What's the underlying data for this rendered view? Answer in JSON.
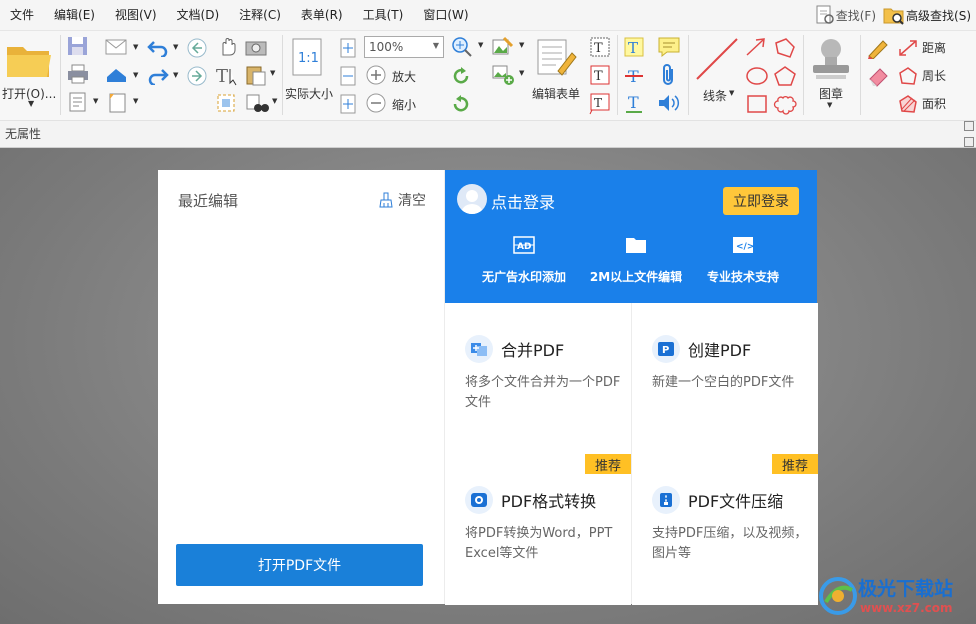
{
  "menu": {
    "items": [
      "文件",
      "编辑(E)",
      "视图(V)",
      "文档(D)",
      "注释(C)",
      "表单(R)",
      "工具(T)",
      "窗口(W)"
    ],
    "find_label": "查找(F)",
    "advanced_find_label": "高级查找(S)"
  },
  "ribbon": {
    "open_label": "打开(O)...",
    "actual_size_label": "实际大小",
    "zoom_value": "100%",
    "zoom_in_label": "放大",
    "zoom_out_label": "缩小",
    "edit_form_label": "编辑表单",
    "line_label": "线条",
    "stamp_label": "图章",
    "distance_label": "距离",
    "perimeter_label": "周长",
    "area_label": "面积"
  },
  "statusbar": {
    "label": "无属性"
  },
  "start_panel": {
    "recent_title": "最近编辑",
    "clear_label": "清空",
    "open_pdf_button": "打开PDF文件",
    "login_text": "点击登录",
    "login_button": "立即登录",
    "features": [
      "无广告水印添加",
      "2M以上文件编辑",
      "专业技术支持"
    ],
    "tiles": [
      {
        "name": "合并PDF",
        "desc": "将多个文件合并为一个PDF文件",
        "tag": ""
      },
      {
        "name": "创建PDF",
        "desc": "新建一个空白的PDF文件",
        "tag": ""
      },
      {
        "name": "PDF格式转换",
        "desc": "将PDF转换为Word，PPT Excel等文件",
        "tag": "推荐"
      },
      {
        "name": "PDF文件压缩",
        "desc": "支持PDF压缩，以及视频，图片等",
        "tag": "推荐"
      }
    ]
  },
  "watermark": {
    "text": "极光下载站",
    "url": "www.xz7.com"
  },
  "colors": {
    "accent": "#1a80ea",
    "button_blue": "#1a80d9",
    "login_yellow": "#ffc73a",
    "tag_yellow": "#ffc024"
  }
}
